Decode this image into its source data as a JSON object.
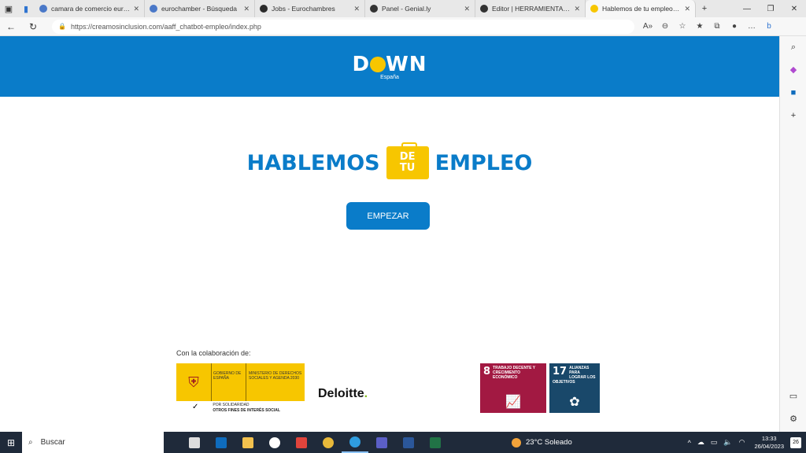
{
  "browser": {
    "tabs": [
      {
        "title": "camara de comercio europ",
        "color": "#4a78c8"
      },
      {
        "title": "eurochamber - Búsqueda",
        "color": "#4a78c8"
      },
      {
        "title": "Jobs - Eurochambres",
        "color": "#2b2b2b"
      },
      {
        "title": "Panel - Genial.ly",
        "color": "#333333"
      },
      {
        "title": "Editor | HERRAMIENTAS DI",
        "color": "#333333"
      },
      {
        "title": "Hablemos de tu empleo - D",
        "color": "#f7c600"
      }
    ],
    "url": "https://creamosinclusion.com/aaff_chatbot-empleo/index.php"
  },
  "page": {
    "logo_text_1": "D",
    "logo_text_2": "WN",
    "logo_sub": "España",
    "hero_left": "HABLEMOS",
    "hero_badge_1": "DE",
    "hero_badge_2": "TU",
    "hero_right": "EMPLEO",
    "start_label": "EMPEZAR",
    "collab_label": "Con la colaboración de:",
    "gov_col1": "GOBIERNO DE ESPAÑA",
    "gov_col2": "MINISTERIO DE DERECHOS SOCIALES Y AGENDA 2030",
    "gov_sub1": "POR SOLIDARIDAD",
    "gov_sub2": "OTROS FINES DE INTERÉS SOCIAL",
    "deloitte": "Deloitte",
    "deloitte_dot": ".",
    "sdg8_num": "8",
    "sdg8_text": "TRABAJO DECENTE Y CRECIMIENTO ECONÓMICO",
    "sdg17_num": "17",
    "sdg17_text": "ALIANZAS PARA LOGRAR LOS OBJETIVOS"
  },
  "taskbar": {
    "search_placeholder": "Buscar",
    "weather": "23°C  Soleado",
    "time": "13:33",
    "date": "26/04/2023",
    "notifications": "26",
    "apps": [
      {
        "name": "task-view",
        "color": "#dddddd"
      },
      {
        "name": "outlook",
        "color": "#0f6cbd"
      },
      {
        "name": "file-explorer",
        "color": "#f2c14e"
      },
      {
        "name": "dell",
        "color": "#ffffff"
      },
      {
        "name": "anydesk",
        "color": "#e0443c"
      },
      {
        "name": "chrome",
        "color": "#e8b93a"
      },
      {
        "name": "edge",
        "color": "#2f9de0"
      },
      {
        "name": "teams",
        "color": "#5b5fc7"
      },
      {
        "name": "word",
        "color": "#2b579a"
      },
      {
        "name": "excel",
        "color": "#217346"
      }
    ]
  }
}
